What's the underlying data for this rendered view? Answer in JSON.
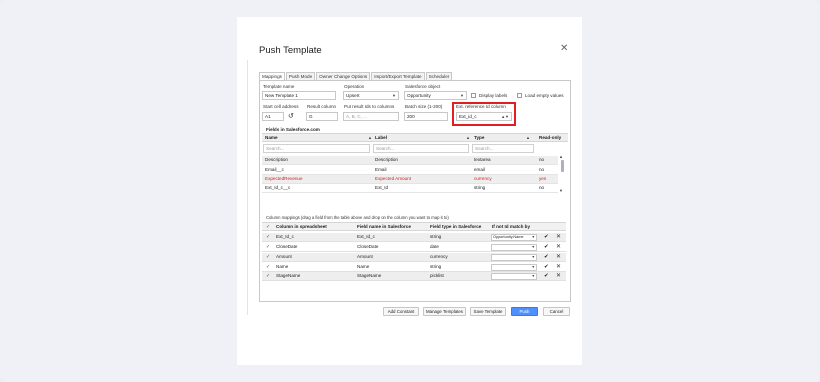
{
  "dialog": {
    "title": "Push Template",
    "close_icon": "close-icon"
  },
  "tabs": [
    {
      "label": "Mappings",
      "active": true
    },
    {
      "label": "Push Mode",
      "active": false
    },
    {
      "label": "Owner Change Options",
      "active": false
    },
    {
      "label": "Import/Export Template",
      "active": false
    },
    {
      "label": "Scheduler",
      "active": false
    }
  ],
  "form": {
    "template_name_label": "Template name",
    "template_name_value": "New Template 1",
    "operation_label": "Operation",
    "operation_value": "Upsert",
    "object_label": "Salesforce object",
    "object_value": "Opportunity",
    "display_labels": "Display labels",
    "load_empty_values": "Load empty values",
    "start_cell_label": "Start cell address",
    "start_cell_value": "A1",
    "result_column_label": "Result column",
    "result_column_value": "G",
    "put_result_label": "Put result Ids to columns",
    "put_result_placeholder": "A, B, C, ...",
    "batch_size_label": "Batch size (1-200)",
    "batch_size_value": "200",
    "ext_ref_label": "Ext. reference Id column",
    "ext_ref_value": "Ext_id_c"
  },
  "fields": {
    "title": "Fields in Salesforce.com",
    "headers": {
      "name": "Name",
      "label": "Label",
      "type": "Type",
      "readonly": "Read-only"
    },
    "search_placeholder": "Search...",
    "rows": [
      {
        "name": "Description",
        "label": "Description",
        "type": "textarea",
        "readonly": "no",
        "highlight": false
      },
      {
        "name": "Email__c",
        "label": "Email",
        "type": "email",
        "readonly": "no",
        "highlight": false
      },
      {
        "name": "ExpectedRevenue",
        "label": "Expected Amount",
        "type": "currency",
        "readonly": "yes",
        "highlight": true
      },
      {
        "name": "Ext_Id_c__c",
        "label": "Ext_Id",
        "type": "string",
        "readonly": "no",
        "highlight": false
      }
    ]
  },
  "mappings": {
    "hint": "Column mappings (drag a field from the table above and drop on the column you want to map it to)",
    "headers": {
      "col": "Column in spreadsheet",
      "field": "Field name in Salesforce",
      "type": "Field type in Salesforce",
      "match": "If not Id match by"
    },
    "rows": [
      {
        "col": "Ext_Id_c",
        "field": "Ext_Id_c",
        "type": "string",
        "match": "Opportunity.Name"
      },
      {
        "col": "CloseDate",
        "field": "CloseDate",
        "type": "date",
        "match": ""
      },
      {
        "col": "Amount",
        "field": "Amount",
        "type": "currency",
        "match": ""
      },
      {
        "col": "Name",
        "field": "Name",
        "type": "string",
        "match": ""
      },
      {
        "col": "StageName",
        "field": "StageName",
        "type": "picklist",
        "match": ""
      }
    ]
  },
  "buttons": {
    "add_constant": "Add Constant",
    "manage_templates": "Manage Templates",
    "save_template": "Save Template",
    "push": "Push",
    "cancel": "Cancel"
  },
  "colors": {
    "accent": "#4d90fe",
    "highlight_box": "#e02020",
    "error_text": "#d21f1f"
  }
}
